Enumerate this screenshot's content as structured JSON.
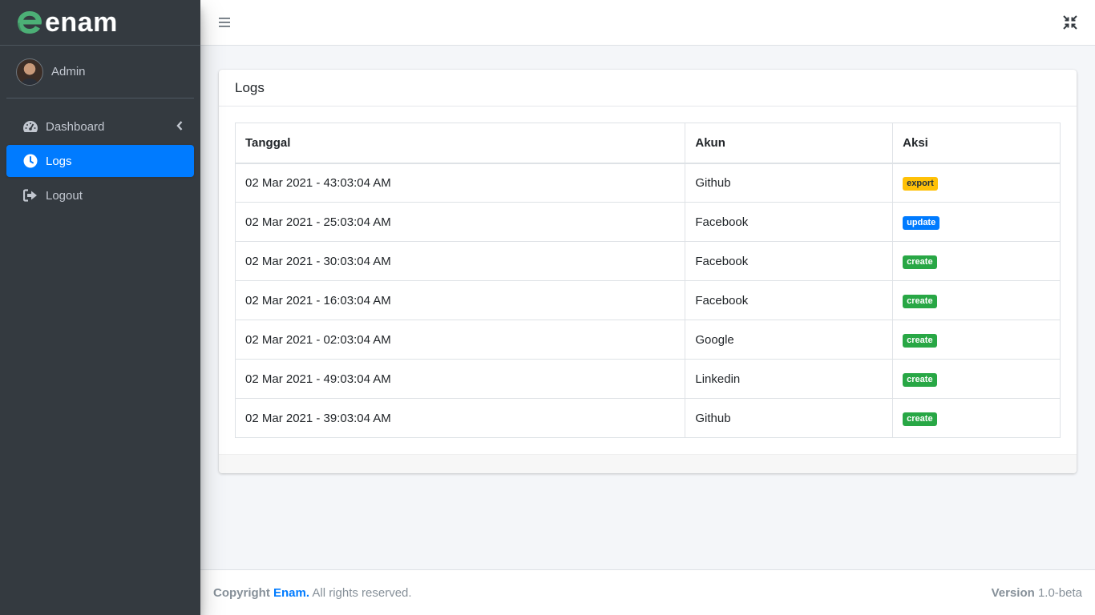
{
  "brand": {
    "name": "enam",
    "accent_color": "#4caf76"
  },
  "user": {
    "name": "Admin"
  },
  "sidebar": {
    "items": [
      {
        "label": "Dashboard",
        "icon": "tachometer-icon",
        "active": false,
        "has_caret": true
      },
      {
        "label": "Logs",
        "icon": "clock-icon",
        "active": true
      },
      {
        "label": "Logout",
        "icon": "sign-out-icon",
        "active": false
      }
    ]
  },
  "topbar": {
    "menu_icon": "hamburger-icon",
    "compress_icon": "compress-icon"
  },
  "card": {
    "title": "Logs",
    "table": {
      "headers": [
        "Tanggal",
        "Akun",
        "Aksi"
      ],
      "rows": [
        {
          "date": "02 Mar 2021 - 43:03:04 AM",
          "akun": "Github",
          "aksi": "export"
        },
        {
          "date": "02 Mar 2021 - 25:03:04 AM",
          "akun": "Facebook",
          "aksi": "update"
        },
        {
          "date": "02 Mar 2021 - 30:03:04 AM",
          "akun": "Facebook",
          "aksi": "create"
        },
        {
          "date": "02 Mar 2021 - 16:03:04 AM",
          "akun": "Facebook",
          "aksi": "create"
        },
        {
          "date": "02 Mar 2021 - 02:03:04 AM",
          "akun": "Google",
          "aksi": "create"
        },
        {
          "date": "02 Mar 2021 - 49:03:04 AM",
          "akun": "Linkedin",
          "aksi": "create"
        },
        {
          "date": "02 Mar 2021 - 39:03:04 AM",
          "akun": "Github",
          "aksi": "create"
        }
      ]
    }
  },
  "footer": {
    "copyright_prefix": "Copyright",
    "brand_link": "Enam.",
    "rights": "All rights reserved.",
    "version_label": "Version",
    "version_value": "1.0-beta"
  },
  "colors": {
    "sidebar_bg": "#343a40",
    "active": "#007bff",
    "export": "#ffc107",
    "update": "#007bff",
    "create": "#28a745"
  }
}
